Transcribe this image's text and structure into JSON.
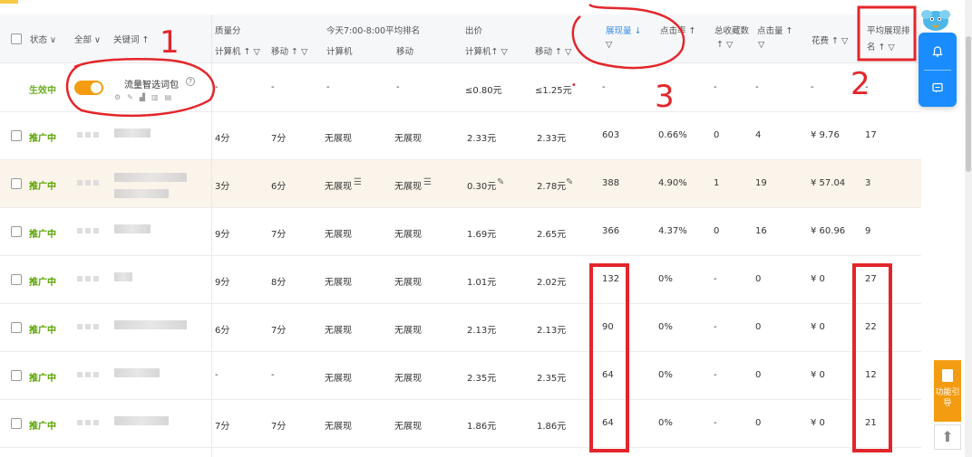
{
  "header": {
    "status_label": "状态",
    "all_label": "全部",
    "keyword_label": "关键词 ↑",
    "quality_group": "质量分",
    "quality_pc": "计算机 ↑ ▽",
    "quality_mobile": "移动 ↑ ▽",
    "rank_group": "今天7:00-8:00平均排名",
    "rank_pc": "计算机",
    "rank_mobile": "移动",
    "bid_group": "出价",
    "bid_pc": "计算机↑ ▽",
    "bid_mobile": "移动 ↑ ▽",
    "impressions": "展现量 ↓",
    "impressions_filter": "▽",
    "ctr": "点击率 ↑",
    "favorites": "总收藏数",
    "favorites_sub": "↑ ▽",
    "clicks": "点击量 ↑",
    "clicks_filter": "▽",
    "cost": "花费 ↑ ▽",
    "avg_rank": "平均展现排",
    "avg_rank_sub": "名 ↑ ▽"
  },
  "package_row": {
    "status": "生效中",
    "name": "流量智选词包",
    "help": "?",
    "quality_pc": "-",
    "quality_mobile": "-",
    "rank_pc": "-",
    "rank_mobile": "-",
    "bid_pc": "≤0.80元",
    "bid_mobile": "≤1.25元",
    "impressions": "-",
    "ctr": "-",
    "favorites": "-",
    "clicks": "-",
    "cost": "-",
    "avg_rank": "-"
  },
  "rows": [
    {
      "status": "推广中",
      "quality_pc": "4分",
      "quality_mobile": "7分",
      "rank_pc": "无展现",
      "rank_mobile": "无展现",
      "bid_pc": "2.33元",
      "bid_mobile": "2.33元",
      "impressions": "603",
      "ctr": "0.66%",
      "favorites": "0",
      "clicks": "4",
      "cost": "¥ 9.76",
      "avg_rank": "17"
    },
    {
      "status": "推广中",
      "quality_pc": "3分",
      "quality_mobile": "6分",
      "rank_pc": "无展现",
      "rank_mobile": "无展现",
      "bid_pc": "0.30元",
      "bid_mobile": "2.78元",
      "impressions": "388",
      "ctr": "4.90%",
      "favorites": "1",
      "clicks": "19",
      "cost": "¥ 57.04",
      "avg_rank": "3"
    },
    {
      "status": "推广中",
      "quality_pc": "9分",
      "quality_mobile": "7分",
      "rank_pc": "无展现",
      "rank_mobile": "无展现",
      "bid_pc": "1.69元",
      "bid_mobile": "2.65元",
      "impressions": "366",
      "ctr": "4.37%",
      "favorites": "0",
      "clicks": "16",
      "cost": "¥ 60.96",
      "avg_rank": "9"
    },
    {
      "status": "推广中",
      "quality_pc": "9分",
      "quality_mobile": "8分",
      "rank_pc": "无展现",
      "rank_mobile": "无展现",
      "bid_pc": "1.01元",
      "bid_mobile": "2.02元",
      "impressions": "132",
      "ctr": "0%",
      "favorites": "-",
      "clicks": "0",
      "cost": "¥ 0",
      "avg_rank": "27"
    },
    {
      "status": "推广中",
      "quality_pc": "6分",
      "quality_mobile": "7分",
      "rank_pc": "无展现",
      "rank_mobile": "无展现",
      "bid_pc": "2.13元",
      "bid_mobile": "2.13元",
      "impressions": "90",
      "ctr": "0%",
      "favorites": "-",
      "clicks": "0",
      "cost": "¥ 0",
      "avg_rank": "22"
    },
    {
      "status": "推广中",
      "quality_pc": "-",
      "quality_mobile": "-",
      "rank_pc": "无展现",
      "rank_mobile": "无展现",
      "bid_pc": "2.35元",
      "bid_mobile": "2.35元",
      "impressions": "64",
      "ctr": "0%",
      "favorites": "-",
      "clicks": "0",
      "cost": "¥ 0",
      "avg_rank": "12"
    },
    {
      "status": "推广中",
      "quality_pc": "7分",
      "quality_mobile": "7分",
      "rank_pc": "无展现",
      "rank_mobile": "无展现",
      "bid_pc": "1.86元",
      "bid_mobile": "1.86元",
      "impressions": "64",
      "ctr": "0%",
      "favorites": "-",
      "clicks": "0",
      "cost": "¥ 0",
      "avg_rank": "21"
    }
  ],
  "widgets": {
    "guide_label": "功能引导",
    "icons": [
      "bell-icon",
      "chat-icon",
      "arrow-up-icon",
      "document-icon"
    ]
  },
  "annotations": {
    "mark_1": "1",
    "mark_2": "2",
    "mark_3": "3"
  },
  "colors": {
    "accent_blue": "#1a8cff",
    "active_green": "#5aa300",
    "toggle_orange": "#f39c12",
    "annotation_red": "#e3262b",
    "highlight_row": "#fbf4ea"
  }
}
